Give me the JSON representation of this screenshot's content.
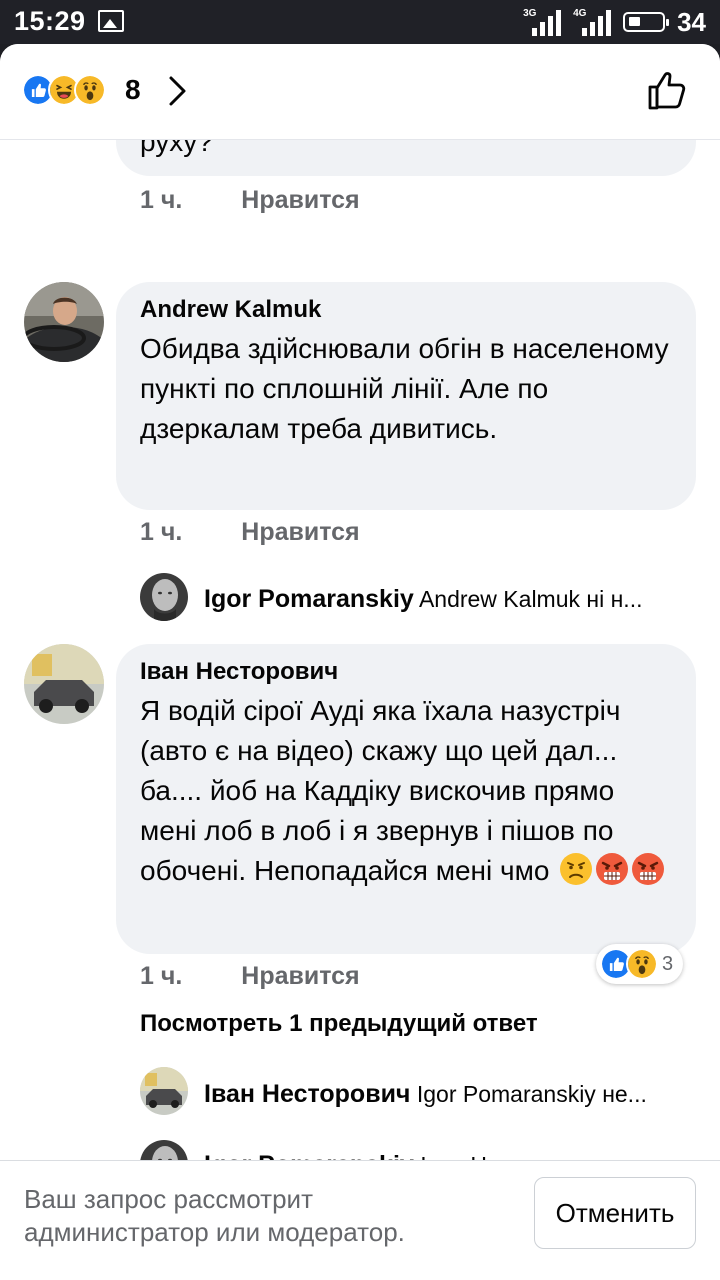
{
  "status_bar": {
    "time": "15:29",
    "signal1_label": "3G",
    "signal2_label": "4G",
    "battery": "34"
  },
  "reactions_header": {
    "count": "8",
    "icons": [
      "like-icon",
      "haha-icon",
      "wow-icon"
    ]
  },
  "comments": [
    {
      "id": "prev",
      "text_fragment": "руху?",
      "time": "1 ч.",
      "like_label": "Нравится"
    },
    {
      "id": "andrew",
      "author": "Andrew Kalmuk",
      "text": "Обидва здійснювали обгін в населеному пункті по сплошній лінії. Але по дзеркалам треба дивитись.",
      "time": "1 ч.",
      "like_label": "Нравится",
      "replies": [
        {
          "author": "Igor Pomaranskiy",
          "preview": "Andrew Kalmuk ні н..."
        }
      ]
    },
    {
      "id": "ivan",
      "author": "Іван Несторович",
      "text": "Я водій сірої Ауді яка їхала назустріч (авто є на відео) скажу що цей дал... ба.... йоб на Каддіку вискочив прямо мені лоб в лоб і я звернув і пішов по обочені. Непопадайся мені чмо",
      "emojis": [
        "frowning-face-emoji",
        "angry-face-emoji",
        "angry-face-emoji"
      ],
      "time": "1 ч.",
      "like_label": "Нравится",
      "reaction_count": "3",
      "view_previous": "Посмотреть 1 предыдущий ответ",
      "replies": [
        {
          "author": "Іван Несторович",
          "preview": "Igor Pomaranskiy не..."
        },
        {
          "author": "Igor Pomaranskiy",
          "preview": "Іван Несторович ......"
        }
      ]
    }
  ],
  "footer": {
    "message": "Ваш запрос рассмотрит администратор или модератор.",
    "cancel_label": "Отменить"
  },
  "colors": {
    "accent_blue": "#1877f2",
    "bubble_bg": "#f0f2f5",
    "meta_gray": "#65676b",
    "status_bar_bg": "#202127"
  }
}
